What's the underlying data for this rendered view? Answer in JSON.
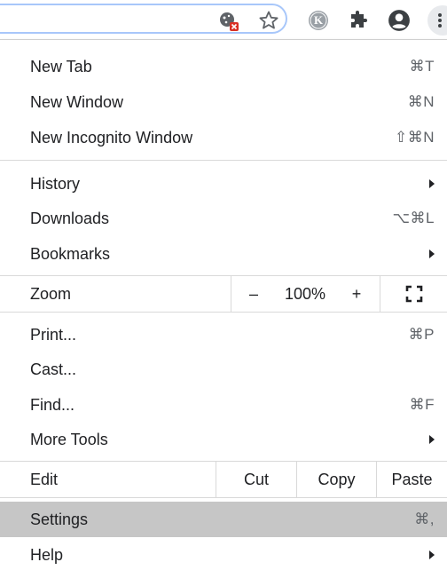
{
  "toolbar": {
    "icons": [
      "cookie-blocked-icon",
      "star-icon",
      "profile-k-icon",
      "puzzle-extensions-icon",
      "account-icon",
      "more-vertical-icon"
    ],
    "profile_letter": "K"
  },
  "menu": {
    "new_tab": {
      "label": "New Tab",
      "shortcut": "⌘T"
    },
    "new_window": {
      "label": "New Window",
      "shortcut": "⌘N"
    },
    "new_incognito": {
      "label": "New Incognito Window",
      "shortcut": "⇧⌘N"
    },
    "history": {
      "label": "History"
    },
    "downloads": {
      "label": "Downloads",
      "shortcut": "⌥⌘L"
    },
    "bookmarks": {
      "label": "Bookmarks"
    },
    "zoom": {
      "label": "Zoom",
      "minus": "–",
      "level": "100%",
      "plus": "+"
    },
    "print": {
      "label": "Print...",
      "shortcut": "⌘P"
    },
    "cast": {
      "label": "Cast..."
    },
    "find": {
      "label": "Find...",
      "shortcut": "⌘F"
    },
    "more_tools": {
      "label": "More Tools"
    },
    "edit": {
      "label": "Edit",
      "cut": "Cut",
      "copy": "Copy",
      "paste": "Paste"
    },
    "settings": {
      "label": "Settings",
      "shortcut": "⌘,"
    },
    "help": {
      "label": "Help"
    }
  }
}
